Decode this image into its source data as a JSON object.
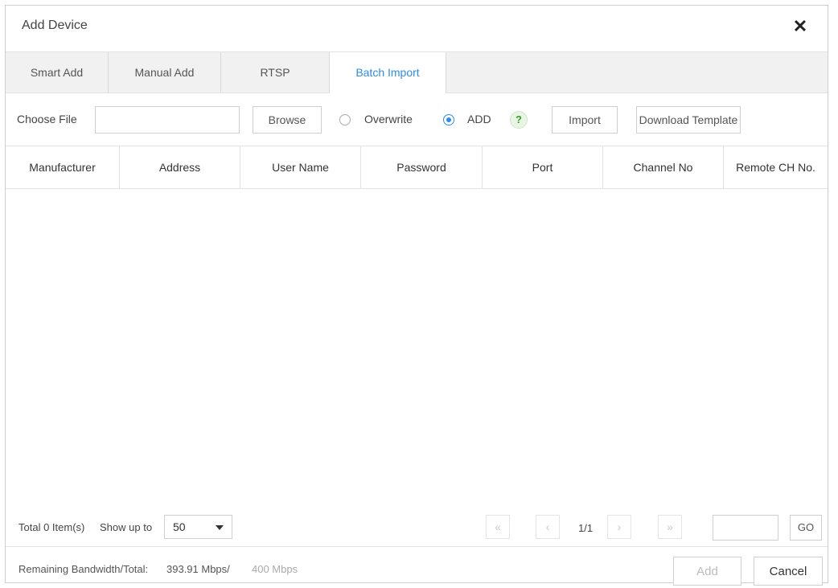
{
  "dialog": {
    "title": "Add Device",
    "close_icon": "close-icon"
  },
  "tabs": [
    {
      "label": "Smart Add",
      "active": false
    },
    {
      "label": "Manual Add",
      "active": false
    },
    {
      "label": "RTSP",
      "active": false
    },
    {
      "label": "Batch Import",
      "active": true
    }
  ],
  "toolbar": {
    "choose_file_label": "Choose File",
    "file_value": "",
    "browse_label": "Browse",
    "overwrite_label": "Overwrite",
    "add_label": "ADD",
    "selected_mode": "ADD",
    "help_icon": "help-icon",
    "help_glyph": "?",
    "import_label": "Import",
    "download_template_label": "Download Template"
  },
  "table": {
    "columns": [
      "Manufacturer",
      "Address",
      "User Name",
      "Password",
      "Port",
      "Channel No",
      "Remote CH No."
    ],
    "rows": []
  },
  "pager": {
    "total_label": "Total 0 Item(s)",
    "show_up_to_label": "Show up to",
    "page_size": "50",
    "first_glyph": "«",
    "prev_glyph": "‹",
    "page_indicator": "1/1",
    "next_glyph": "›",
    "last_glyph": "»",
    "goto_value": "",
    "go_label": "GO"
  },
  "footer": {
    "bandwidth_label": "Remaining Bandwidth/Total:",
    "bandwidth_remaining": "393.91 Mbps/",
    "bandwidth_total": "400 Mbps",
    "add_label": "Add",
    "cancel_label": "Cancel"
  },
  "colors": {
    "accent": "#2d8cf0",
    "help_green": "#3a9b2a"
  }
}
